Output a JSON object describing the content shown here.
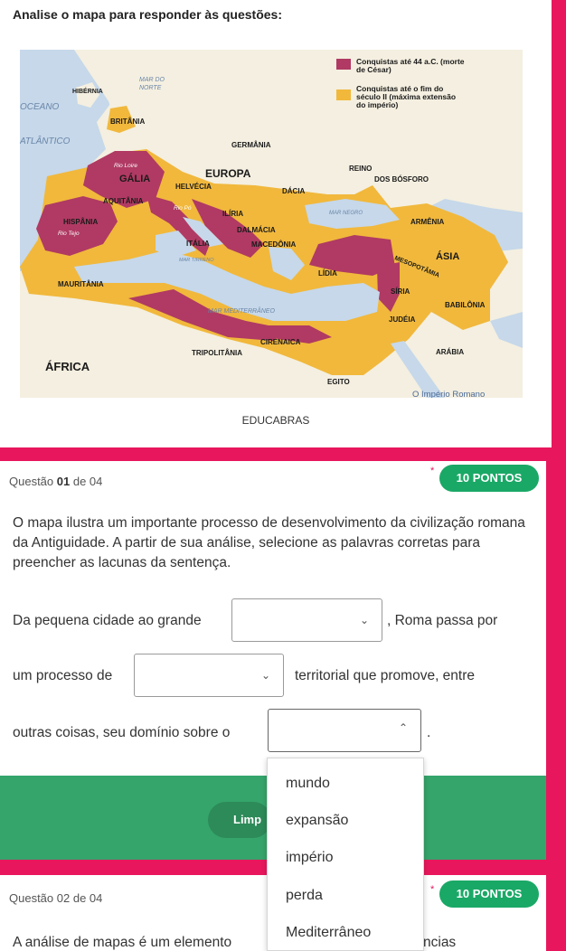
{
  "instruction": "Analise o mapa para responder às questões:",
  "map": {
    "legend": {
      "caesar": "Conquistas até 44 a.C. (morte de César)",
      "caesar_line1": "Conquistas até 44 a.C. (morte",
      "caesar_line2": "de César)",
      "max_line1": "Conquistas até o fim do",
      "max_line2": "século II (máxima extensão",
      "max_line3": "do império)"
    },
    "labels": {
      "hibernia": "HIBÉRNIA",
      "mar_do_norte_1": "MAR DO",
      "mar_do_norte_2": "NORTE",
      "oceano": "OCEANO",
      "atlantico": "ATLÂNTICO",
      "britania": "BRITÂNIA",
      "germania": "GERMÂNIA",
      "rio_loire": "Rio Loire",
      "galia": "GÁLIA",
      "europa": "EUROPA",
      "helvecia": "HELVÉCIA",
      "dacia": "DÁCIA",
      "reino": "REINO",
      "dos_bosforo": "DOS BÓSFORO",
      "aquitania": "AQUITÂNIA",
      "rio_po": "Rio Pó",
      "iliria": "ILÍRIA",
      "dalmacia": "DALMÁCIA",
      "mar_negro": "MAR NEGRO",
      "armenia": "ARMÊNIA",
      "hispania": "HISPÂNIA",
      "rio_tejo": "Rio Tejo",
      "italia": "ITÁLIA",
      "macedonia": "MACEDÔNIA",
      "asia": "ÁSIA",
      "mesopotamia": "MESOPOTÂMIA",
      "mar_tirreno": "MAR TIRRENO",
      "lidia": "LÍDIA",
      "mauritania": "MAURITÂNIA",
      "siria": "SÍRIA",
      "babilonia": "BABILÔNIA",
      "mar_mediterraneo": "MAR MEDITERRÂNEO",
      "judeia": "JUDÉIA",
      "cirenaica": "CIRENAICA",
      "tripolitania": "TRIPOLITÂNIA",
      "arabia": "ARÁBIA",
      "africa": "ÁFRICA",
      "egito": "EGITO",
      "caption": "O Império Romano"
    },
    "colors": {
      "water": "#c6d8ea",
      "land": "#f4efe0",
      "caesar": "#b03a63",
      "max_extension": "#f1b83c",
      "label": "#1a1a1a"
    },
    "source": "EDUCABRAS"
  },
  "question1": {
    "number_prefix": "Questão ",
    "number": "01",
    "of": " de 04",
    "points": "10 PONTOS",
    "star": "*",
    "prompt": "O mapa ilustra um importante processo de desenvolvimento da civilização romana da Antiguidade. A partir de sua análise, selecione as palavras corretas para preencher as lacunas da sentença.",
    "line1_before": "Da pequena cidade ao grande",
    "line1_after": ", Roma passa por",
    "line2_before": "um processo de",
    "line2_after": "territorial que promove, entre",
    "line3_before": "outras coisas, seu domínio sobre o",
    "line3_after": ".",
    "select1_value": "",
    "select2_value": "",
    "select3_value": ""
  },
  "clear_button": "Limp",
  "dropdown": {
    "options": [
      "mundo",
      "expansão",
      "império",
      "perda",
      "Mediterrâneo"
    ]
  },
  "question2": {
    "number_prefix": "Questão ",
    "number": "02",
    "of": " de 04",
    "points": "10 PONTOS",
    "star": "*",
    "text_start": "A análise de mapas é um elemento",
    "text_tail": "ncias"
  }
}
